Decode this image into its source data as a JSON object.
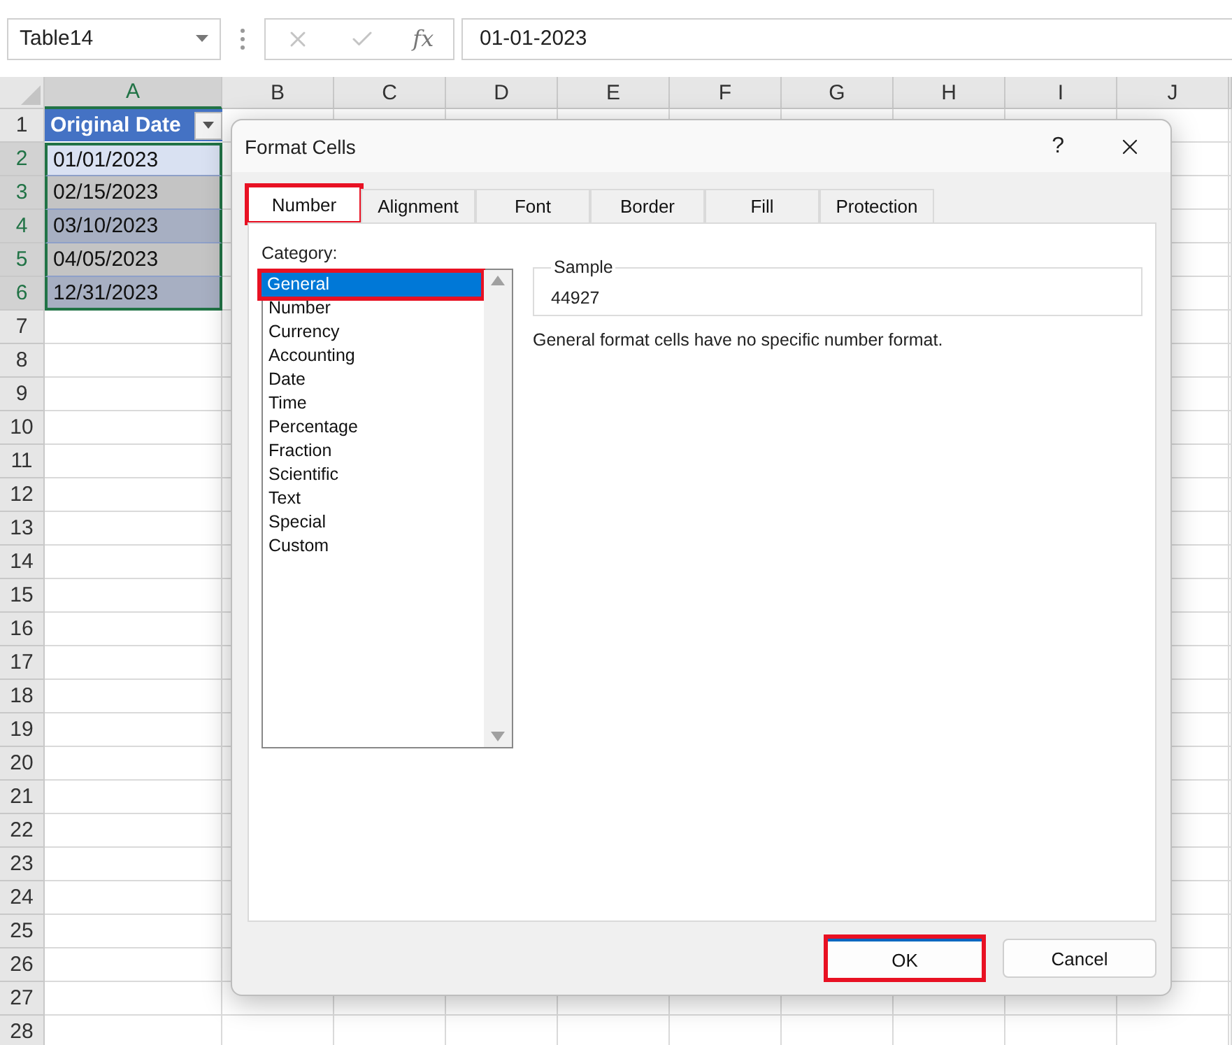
{
  "name_box": {
    "value": "Table14"
  },
  "formula_bar": {
    "function_label": "fx",
    "value": "01-01-2023"
  },
  "sheet": {
    "columns": [
      {
        "label": "A",
        "selected": true
      },
      {
        "label": "B",
        "selected": false
      },
      {
        "label": "C",
        "selected": false
      },
      {
        "label": "D",
        "selected": false
      },
      {
        "label": "E",
        "selected": false
      },
      {
        "label": "F",
        "selected": false
      },
      {
        "label": "G",
        "selected": false
      },
      {
        "label": "H",
        "selected": false
      },
      {
        "label": "I",
        "selected": false
      },
      {
        "label": "J",
        "selected": false
      }
    ],
    "rows": [
      {
        "label": "1",
        "selected": false
      },
      {
        "label": "2",
        "selected": true
      },
      {
        "label": "3",
        "selected": true
      },
      {
        "label": "4",
        "selected": true
      },
      {
        "label": "5",
        "selected": true
      },
      {
        "label": "6",
        "selected": true
      },
      {
        "label": "7",
        "selected": false
      },
      {
        "label": "8",
        "selected": false
      },
      {
        "label": "9",
        "selected": false
      },
      {
        "label": "10",
        "selected": false
      },
      {
        "label": "11",
        "selected": false
      },
      {
        "label": "12",
        "selected": false
      },
      {
        "label": "13",
        "selected": false
      },
      {
        "label": "14",
        "selected": false
      },
      {
        "label": "15",
        "selected": false
      },
      {
        "label": "16",
        "selected": false
      },
      {
        "label": "17",
        "selected": false
      },
      {
        "label": "18",
        "selected": false
      },
      {
        "label": "19",
        "selected": false
      },
      {
        "label": "20",
        "selected": false
      },
      {
        "label": "21",
        "selected": false
      },
      {
        "label": "22",
        "selected": false
      },
      {
        "label": "23",
        "selected": false
      },
      {
        "label": "24",
        "selected": false
      },
      {
        "label": "25",
        "selected": false
      },
      {
        "label": "26",
        "selected": false
      },
      {
        "label": "27",
        "selected": false
      },
      {
        "label": "28",
        "selected": false
      }
    ],
    "table": {
      "header": "Original Date",
      "values": [
        "01/01/2023",
        "02/15/2023",
        "03/10/2023",
        "04/05/2023",
        "12/31/2023"
      ]
    }
  },
  "dialog": {
    "title": "Format Cells",
    "help": "?",
    "tabs": [
      {
        "label": "Number",
        "selected": true,
        "highlighted": true
      },
      {
        "label": "Alignment",
        "selected": false,
        "highlighted": false
      },
      {
        "label": "Font",
        "selected": false,
        "highlighted": false
      },
      {
        "label": "Border",
        "selected": false,
        "highlighted": false
      },
      {
        "label": "Fill",
        "selected": false,
        "highlighted": false
      },
      {
        "label": "Protection",
        "selected": false,
        "highlighted": false
      }
    ],
    "category_label": "Category:",
    "categories": [
      {
        "label": "General",
        "selected": true,
        "highlighted": true
      },
      {
        "label": "Number",
        "selected": false,
        "highlighted": false
      },
      {
        "label": "Currency",
        "selected": false,
        "highlighted": false
      },
      {
        "label": "Accounting",
        "selected": false,
        "highlighted": false
      },
      {
        "label": "Date",
        "selected": false,
        "highlighted": false
      },
      {
        "label": "Time",
        "selected": false,
        "highlighted": false
      },
      {
        "label": "Percentage",
        "selected": false,
        "highlighted": false
      },
      {
        "label": "Fraction",
        "selected": false,
        "highlighted": false
      },
      {
        "label": "Scientific",
        "selected": false,
        "highlighted": false
      },
      {
        "label": "Text",
        "selected": false,
        "highlighted": false
      },
      {
        "label": "Special",
        "selected": false,
        "highlighted": false
      },
      {
        "label": "Custom",
        "selected": false,
        "highlighted": false
      }
    ],
    "sample_label": "Sample",
    "sample_value": "44927",
    "description": "General format cells have no specific number format.",
    "buttons": [
      {
        "label": "OK",
        "highlighted": true
      },
      {
        "label": "Cancel",
        "highlighted": false
      }
    ]
  }
}
